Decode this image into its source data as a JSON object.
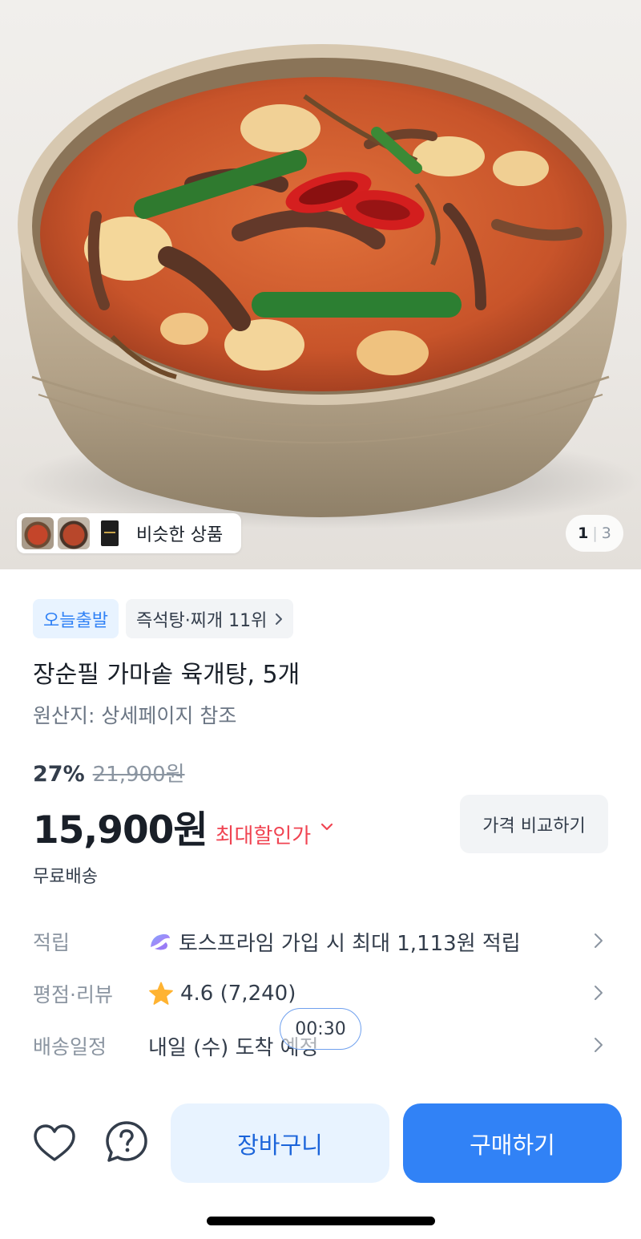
{
  "gallery": {
    "similar_label": "비슷한 상품",
    "page_current": "1",
    "page_separator": "|",
    "page_total": "3"
  },
  "badges": {
    "today_ship": "오늘출발",
    "rank": "즉석탕·찌개 11위"
  },
  "product": {
    "title": "장순필 가마솥 육개탕, 5개",
    "origin": "원산지: 상세페이지 참조",
    "discount_rate": "27%",
    "original_price": "21,900원",
    "price": "15,900원",
    "max_discount_label": "최대할인가",
    "compare_button": "가격 비교하기",
    "shipping": "무료배송"
  },
  "info_rows": {
    "points": {
      "label": "적립",
      "value": "토스프라임 가입 시 최대 1,113원 적립"
    },
    "rating": {
      "label": "평점·리뷰",
      "value": "4.6 (7,240)"
    },
    "delivery": {
      "label": "배송일정",
      "value": "내일 (수) 도착 예정"
    }
  },
  "timer": "00:30",
  "bottom_bar": {
    "cart_label": "장바구니",
    "buy_label": "구매하기"
  },
  "colors": {
    "accent_blue": "#3182f6",
    "sale_red": "#f04452",
    "star": "#ffb331"
  }
}
